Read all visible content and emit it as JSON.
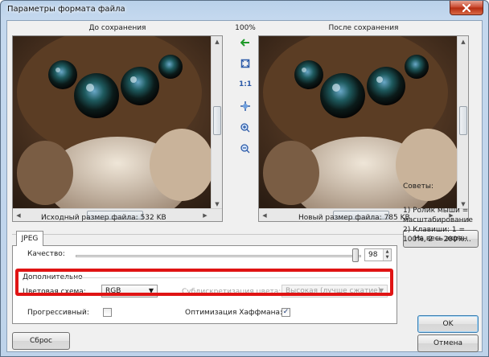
{
  "window": {
    "title": "Параметры формата файла",
    "close_icon": "close-icon"
  },
  "preview": {
    "before_label": "До сохранения",
    "after_label": "После сохранения",
    "zoom_percent": "100%",
    "original_size_label": "Исходный размер файла:  532 KB",
    "new_size_label": "Новый размер файла:  785 KB"
  },
  "toolbar": {
    "tools": [
      {
        "name": "back-arrow-icon",
        "glyph": "←"
      },
      {
        "name": "fit-to-window-icon",
        "glyph": "⛶"
      },
      {
        "name": "actual-size-icon",
        "glyph": "1:1"
      },
      {
        "name": "pan-icon",
        "glyph": "✥"
      },
      {
        "name": "zoom-in-icon",
        "glyph": "⊕"
      },
      {
        "name": "zoom-out-icon",
        "glyph": "⊖"
      }
    ]
  },
  "tabs": {
    "jpeg": "JPEG"
  },
  "jpeg": {
    "quality_label": "Качество:",
    "quality_value": "98",
    "quality_fraction": 0.98,
    "advanced_label": "Дополнительно",
    "color_scheme_label": "Цветовая схема:",
    "color_scheme_value": "RGB",
    "subsampling_label": "Субдискретизация цвета:",
    "subsampling_value": "Высокая (лучше сжатие)",
    "progressive_label": "Прогрессивный:",
    "progressive_checked": false,
    "huffman_label": "Оптимизация Хаффмана:",
    "huffman_checked": true
  },
  "buttons": {
    "fullscreen": "На весь экран",
    "reset": "Сброс",
    "ok": "OK",
    "cancel": "Отмена"
  },
  "tips": {
    "title": "Советы:",
    "items": [
      "1) Ролик мыши = масштабирование",
      "2) Клавиши: 1 = 100%, 2 = 200%..."
    ]
  },
  "colors": {
    "highlight": "#e01414",
    "accent": "#2b5aa8"
  }
}
